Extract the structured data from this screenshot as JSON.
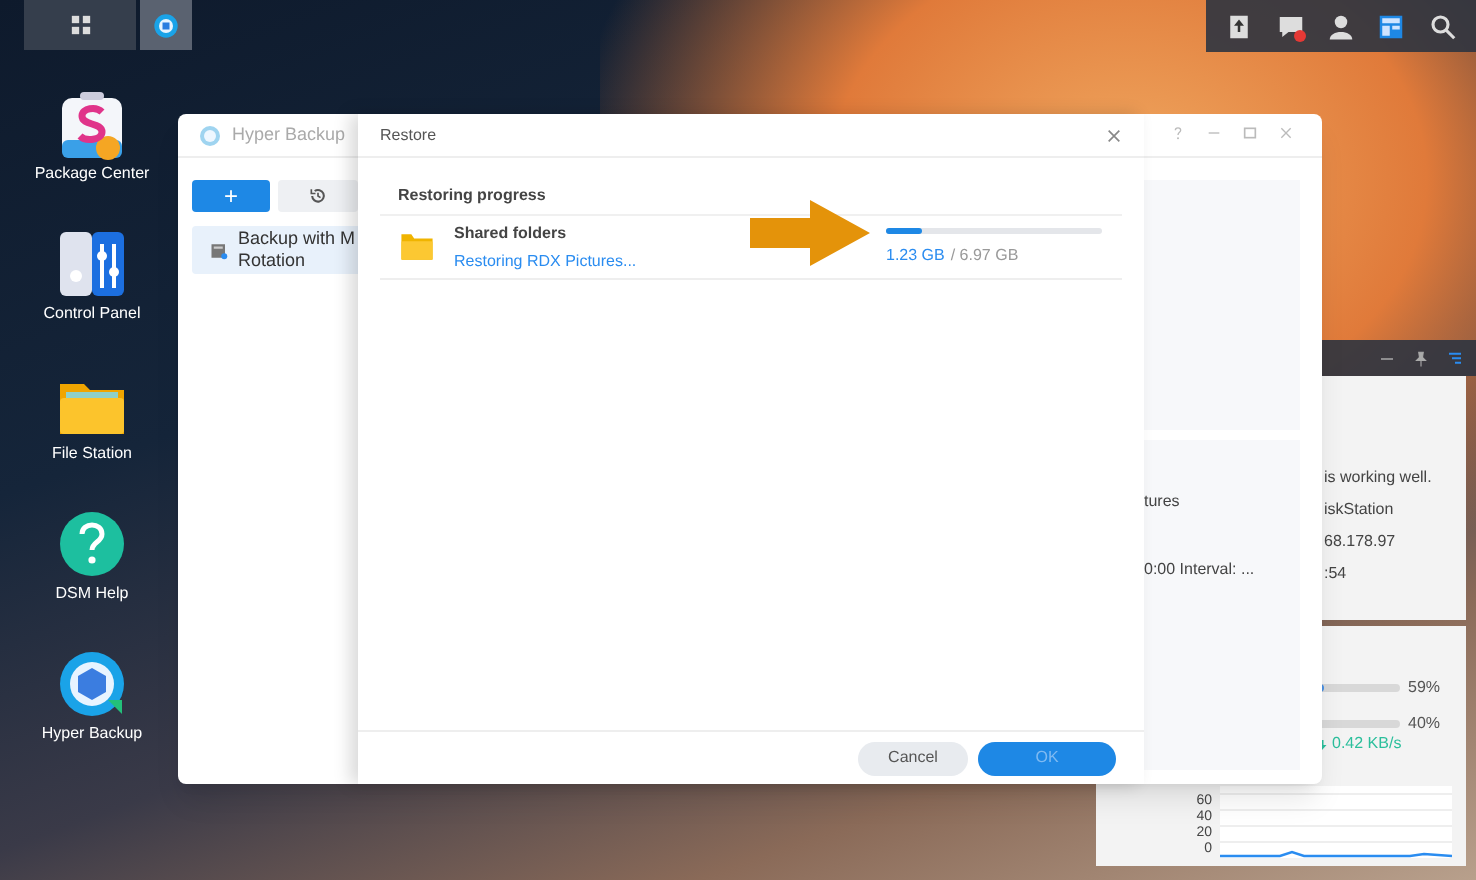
{
  "top_bar": {
    "tray_icons": [
      {
        "kind": "upload",
        "badge": false
      },
      {
        "kind": "chat",
        "badge": true
      },
      {
        "kind": "user",
        "badge": false
      },
      {
        "kind": "widgets",
        "badge": false
      },
      {
        "kind": "search",
        "badge": false
      }
    ]
  },
  "desktop_icons": [
    {
      "kind": "package",
      "label": "Package Center"
    },
    {
      "kind": "control",
      "label": "Control Panel"
    },
    {
      "kind": "folder",
      "label": "File Station"
    },
    {
      "kind": "help",
      "label": "DSM Help"
    },
    {
      "kind": "backup",
      "label": "Hyper Backup"
    }
  ],
  "hyper_backup_window": {
    "title": "Hyper Backup",
    "add_button": "+",
    "task_lines": [
      "Backup with M",
      "Rotation"
    ],
    "background_texts": [
      "tures",
      "0:00 Interval: ..."
    ]
  },
  "restore_dialog": {
    "title": "Restore",
    "section_title": "Restoring progress",
    "item": {
      "name": "Shared folders",
      "status": "Restoring RDX Pictures...",
      "level": 0.17,
      "done": "1.23 GB",
      "total": "/ 6.97 GB"
    },
    "buttons": [
      {
        "label": "Cancel",
        "kind": "secondary",
        "disabled": false
      },
      {
        "label": "OK",
        "kind": "primary",
        "disabled": true
      }
    ]
  },
  "widgets": {
    "status_lines": [
      "is working well.",
      "iskStation",
      "68.178.97",
      ":54"
    ],
    "resources": [
      {
        "level": 0.1,
        "reading": "59%"
      },
      {
        "level": 0,
        "reading": "40%"
      }
    ],
    "network": "0.42 KB/s",
    "chart_ticks": [
      "60",
      "40",
      "20",
      "0"
    ]
  }
}
